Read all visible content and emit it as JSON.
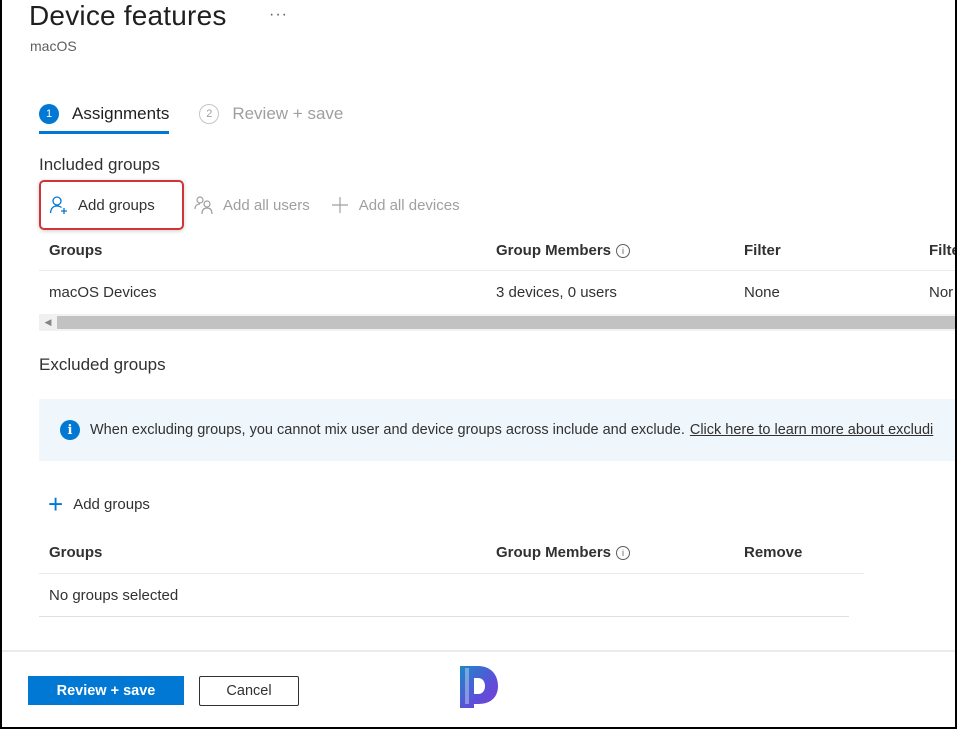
{
  "header": {
    "title": "Device features",
    "more_label": "···",
    "subtitle": "macOS"
  },
  "steps": [
    {
      "number": "1",
      "label": "Assignments",
      "active": true
    },
    {
      "number": "2",
      "label": "Review + save",
      "active": false
    }
  ],
  "included": {
    "section_title": "Included groups",
    "commands": [
      {
        "label": "Add groups",
        "icon": "add-person-icon",
        "enabled": true
      },
      {
        "label": "Add all users",
        "icon": "people-icon",
        "enabled": false
      },
      {
        "label": "Add all devices",
        "icon": "plus-icon",
        "enabled": false
      }
    ],
    "columns": [
      "Groups",
      "Group Members",
      "Filter",
      "Filter mode"
    ],
    "columns_visible": [
      "Groups",
      "Group Members",
      "Filter",
      "Filte"
    ],
    "rows": [
      {
        "group": "macOS Devices",
        "members": "3 devices, 0 users",
        "filter": "None",
        "filter_mode": "Nor"
      }
    ]
  },
  "excluded": {
    "section_title": "Excluded groups",
    "info_message": "When excluding groups, you cannot mix user and device groups across include and exclude.",
    "info_link": "Click here to learn more about excludi",
    "add_label": "Add groups",
    "columns": [
      "Groups",
      "Group Members",
      "Remove"
    ],
    "empty_text": "No groups selected"
  },
  "footer": {
    "primary_label": "Review + save",
    "secondary_label": "Cancel"
  },
  "colors": {
    "accent": "#0078d4",
    "highlight_border": "#d13438",
    "info_bg": "#eff6fc"
  }
}
